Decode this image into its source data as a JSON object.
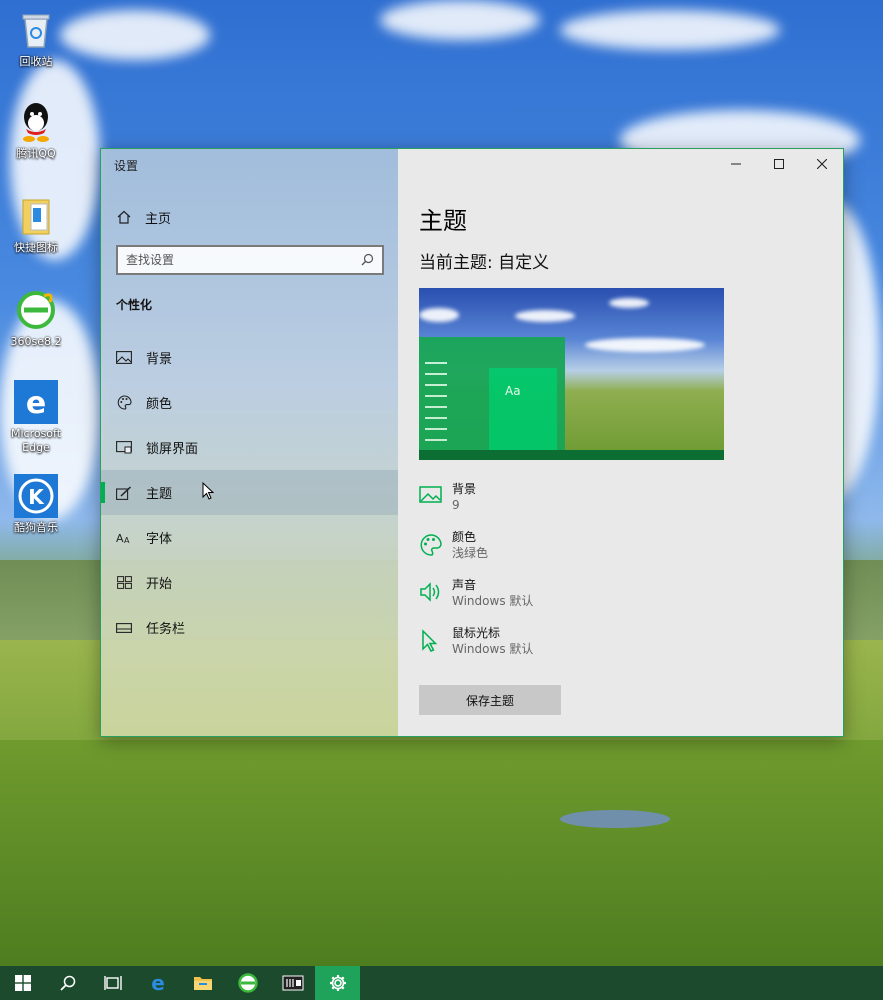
{
  "desktop": {
    "icons": [
      {
        "label": "回收站",
        "icon": "recycle-bin-icon"
      },
      {
        "label": "腾讯QQ",
        "icon": "qq-icon"
      },
      {
        "label": "快捷图标",
        "icon": "folder-icon"
      },
      {
        "label": "360se8.2",
        "icon": "360-browser-icon"
      },
      {
        "label": "Microsoft Edge",
        "icon": "edge-icon"
      },
      {
        "label": "酷狗音乐",
        "icon": "kugou-icon"
      }
    ]
  },
  "window": {
    "title": "设置",
    "accent_color": "#00b050",
    "sidebar": {
      "home_label": "主页",
      "search_placeholder": "查找设置",
      "section_title": "个性化",
      "items": [
        {
          "label": "背景",
          "icon": "picture-icon"
        },
        {
          "label": "颜色",
          "icon": "palette-icon"
        },
        {
          "label": "锁屏界面",
          "icon": "lock-screen-icon"
        },
        {
          "label": "主题",
          "icon": "theme-brush-icon",
          "active": true
        },
        {
          "label": "字体",
          "icon": "font-icon"
        },
        {
          "label": "开始",
          "icon": "start-grid-icon"
        },
        {
          "label": "任务栏",
          "icon": "taskbar-icon"
        }
      ]
    },
    "main": {
      "heading": "主题",
      "current_theme": "当前主题: 自定义",
      "preview_tile_text": "Aa",
      "properties": [
        {
          "title": "背景",
          "value": "9",
          "icon": "picture-icon"
        },
        {
          "title": "颜色",
          "value": "浅绿色",
          "icon": "palette-icon"
        },
        {
          "title": "声音",
          "value": "Windows 默认",
          "icon": "speaker-icon"
        },
        {
          "title": "鼠标光标",
          "value": "Windows 默认",
          "icon": "pointer-icon"
        }
      ],
      "save_label": "保存主题"
    }
  },
  "taskbar": {
    "buttons": [
      "start-icon",
      "search-icon",
      "task-view-icon",
      "edge-icon",
      "file-explorer-icon",
      "360-browser-icon",
      "media-player-icon",
      "settings-gear-icon"
    ],
    "active": "settings-gear-icon"
  }
}
